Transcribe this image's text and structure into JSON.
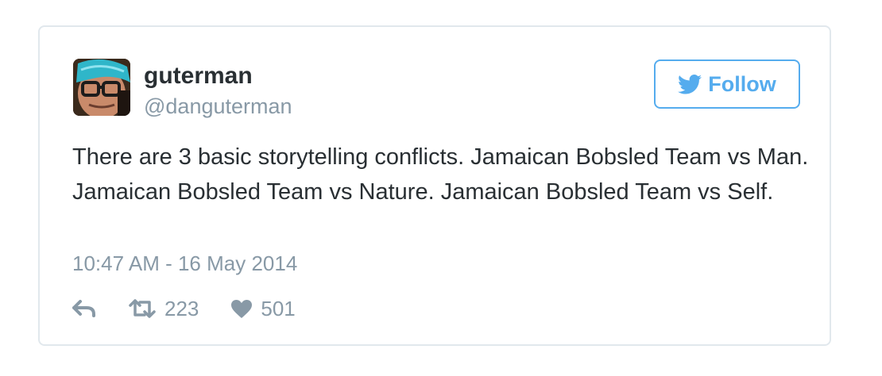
{
  "user": {
    "display_name": "guterman",
    "handle": "@danguterman"
  },
  "follow_button": {
    "label": "Follow",
    "icon": "twitter-bird-icon"
  },
  "tweet": {
    "text": "There are 3 basic storytelling conflicts. Jamaican Bobsled Team vs Man. Jamaican Bobsled Team vs Nature. Jamaican Bobsled Team vs Self.",
    "timestamp": "10:47 AM - 16 May 2014"
  },
  "actions": {
    "reply_icon": "reply-icon",
    "retweet_icon": "retweet-icon",
    "retweet_count": "223",
    "like_icon": "heart-icon",
    "like_count": "501"
  },
  "colors": {
    "accent": "#55acee",
    "text": "#292f33",
    "muted": "#8899a6",
    "border": "#e1e8ed"
  }
}
